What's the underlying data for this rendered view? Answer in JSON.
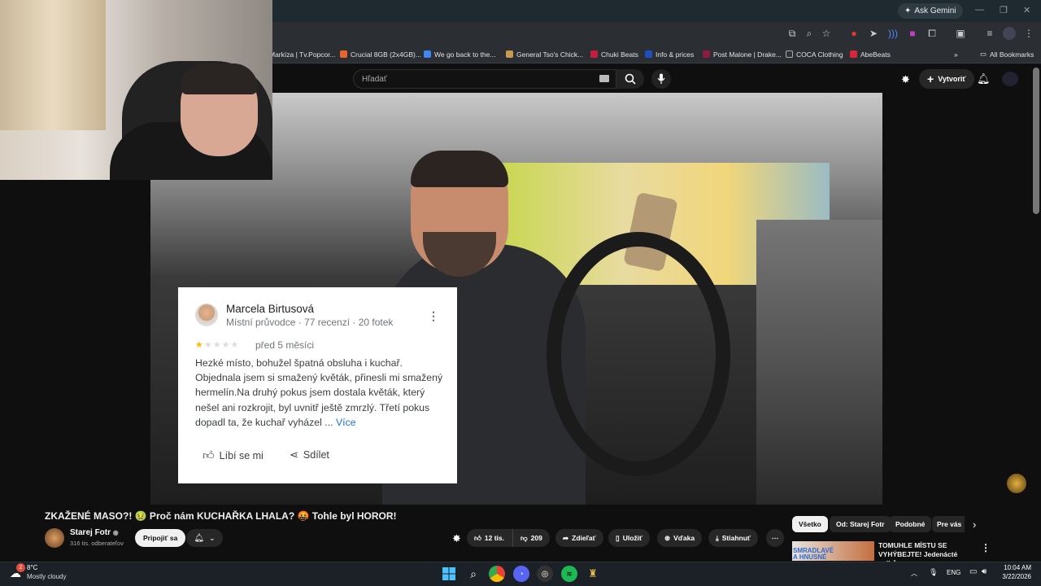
{
  "browser": {
    "ask_gemini": "Ask Gemini",
    "bookmarks": [
      {
        "label": "Markíza | Tv.Popcor...",
        "color": "#8e8e8e"
      },
      {
        "label": "Crucial 8GB (2x4GB)...",
        "color": "#e8662c"
      },
      {
        "label": "We go back to the...",
        "color": "#4285f4"
      },
      {
        "label": "General Tso's Chick...",
        "color": "#c89a4e"
      },
      {
        "label": "Chuki Beats",
        "color": "#c41e3a"
      },
      {
        "label": "Info & prices",
        "color": "#1f4fbf"
      },
      {
        "label": "Post Malone | Drake...",
        "color": "#8c1c3f"
      },
      {
        "label": "COCA Clothing",
        "color": "#333333"
      },
      {
        "label": "AbeBeats",
        "color": "#d9263a"
      }
    ],
    "all_bookmarks": "All Bookmarks"
  },
  "youtube": {
    "search_placeholder": "Hľadať",
    "create_label": "Vytvoriť"
  },
  "review": {
    "name": "Marcela Birtusová",
    "meta": "Místní průvodce · 77 recenzí · 20 fotek",
    "rating": 1,
    "date": "před 5 měsíci",
    "text": "Hezké místo, bohužel špatná obsluha i kuchař. Objednala jsem si smažený květák, přinesli mi smažený hermelín.Na druhý pokus jsem dostala květák, který nešel ani rozkrojit, byl uvnitř ještě zmrzlý. Třetí pokus dopadl ta, že kuchař vyházel ...",
    "more": "Více",
    "like": "Líbí se mi",
    "share": "Sdílet"
  },
  "video": {
    "title": "ZKAŽENÉ MASO?! 🤢 Proč nám KUCHAŘKA LHALA? 🤬 Tohle byl HOROR!",
    "channel": "Starej Fotr",
    "subscribers": "316 tis. odberateľov",
    "subscribe": "Pripojiť sa",
    "likes": "12 tis.",
    "dislikes": "209",
    "share": "Zdieľať",
    "save": "Uložiť",
    "thanks": "Vďaka",
    "download": "Stiahnuť"
  },
  "chips": [
    "Všetko",
    "Od: Starej Fotr",
    "Podobné",
    "Pre vás"
  ],
  "recommendation": {
    "title": "TOMUHLE MÍSTU SE VYHÝBEJTE! Jedenácté nejhů...",
    "thumb_text": "SMRADLAVÉ A HNUSNÉ"
  },
  "taskbar": {
    "weather_badge": "2",
    "temperature": "8°C",
    "weather": "Mostly cloudy",
    "lang": "ENG",
    "time": "10:04 AM",
    "date": "3/22/2026"
  }
}
